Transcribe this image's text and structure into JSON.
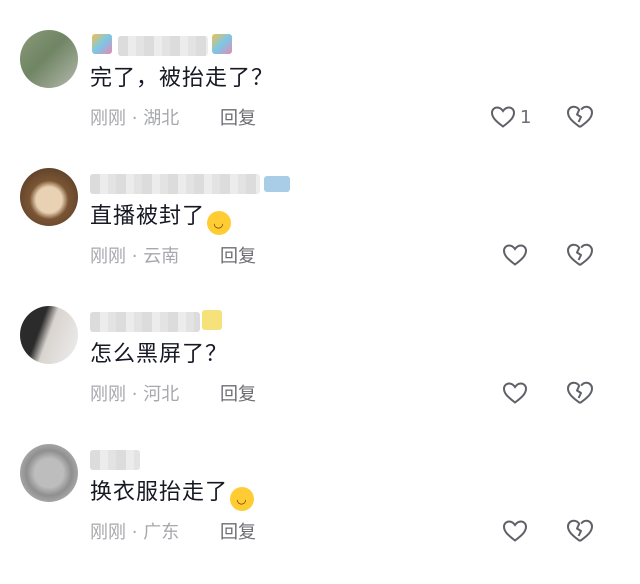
{
  "comments": [
    {
      "text": "完了，被抬走了？",
      "time": "刚刚",
      "separator": "·",
      "location": "湖北",
      "reply_label": "回复",
      "like_count": "1",
      "has_emoji": false
    },
    {
      "text": "直播被封了",
      "time": "刚刚",
      "separator": "·",
      "location": "云南",
      "reply_label": "回复",
      "like_count": "",
      "has_emoji": true
    },
    {
      "text": "怎么黑屏了？",
      "time": "刚刚",
      "separator": "·",
      "location": "河北",
      "reply_label": "回复",
      "like_count": "",
      "has_emoji": false
    },
    {
      "text": "换衣服抬走了",
      "time": "刚刚",
      "separator": "·",
      "location": "广东",
      "reply_label": "回复",
      "like_count": "",
      "has_emoji": true
    }
  ],
  "icons": {
    "like": "heart-outline-icon",
    "dislike": "broken-heart-icon",
    "emoji": "grinning-sweat-emoji"
  },
  "colors": {
    "comment_text": "#161823",
    "meta_text": "#a7a8ad",
    "reply_text": "#6c6d73",
    "icon_stroke": "#5f6068"
  }
}
